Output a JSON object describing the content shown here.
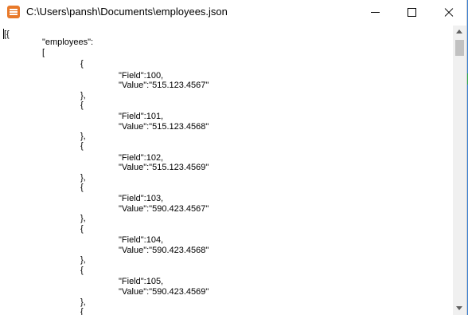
{
  "window": {
    "title": "C:\\Users\\pansh\\Documents\\employees.json",
    "icon": "notepad-icon",
    "controls": [
      "minimize-icon",
      "maximize-icon",
      "close-icon"
    ]
  },
  "editor": {
    "lines": [
      "[{",
      "\"employees\":",
      "[",
      "{",
      "\"Field\":100,",
      "\"Value\":\"515.123.4567\"",
      "},",
      "{",
      "\"Field\":101,",
      "\"Value\":\"515.123.4568\"",
      "},",
      "{",
      "\"Field\":102,",
      "\"Value\":\"515.123.4569\"",
      "},",
      "{",
      "\"Field\":103,",
      "\"Value\":\"590.423.4567\"",
      "},",
      "{",
      "\"Field\":104,",
      "\"Value\":\"590.423.4568\"",
      "},",
      "{",
      "\"Field\":105,",
      "\"Value\":\"590.423.4569\"",
      "},",
      "{"
    ]
  },
  "colors": {
    "accent": "#e8792a",
    "desktop_blue": "#3a7fd1",
    "desktop_green": "#2fa84f"
  }
}
